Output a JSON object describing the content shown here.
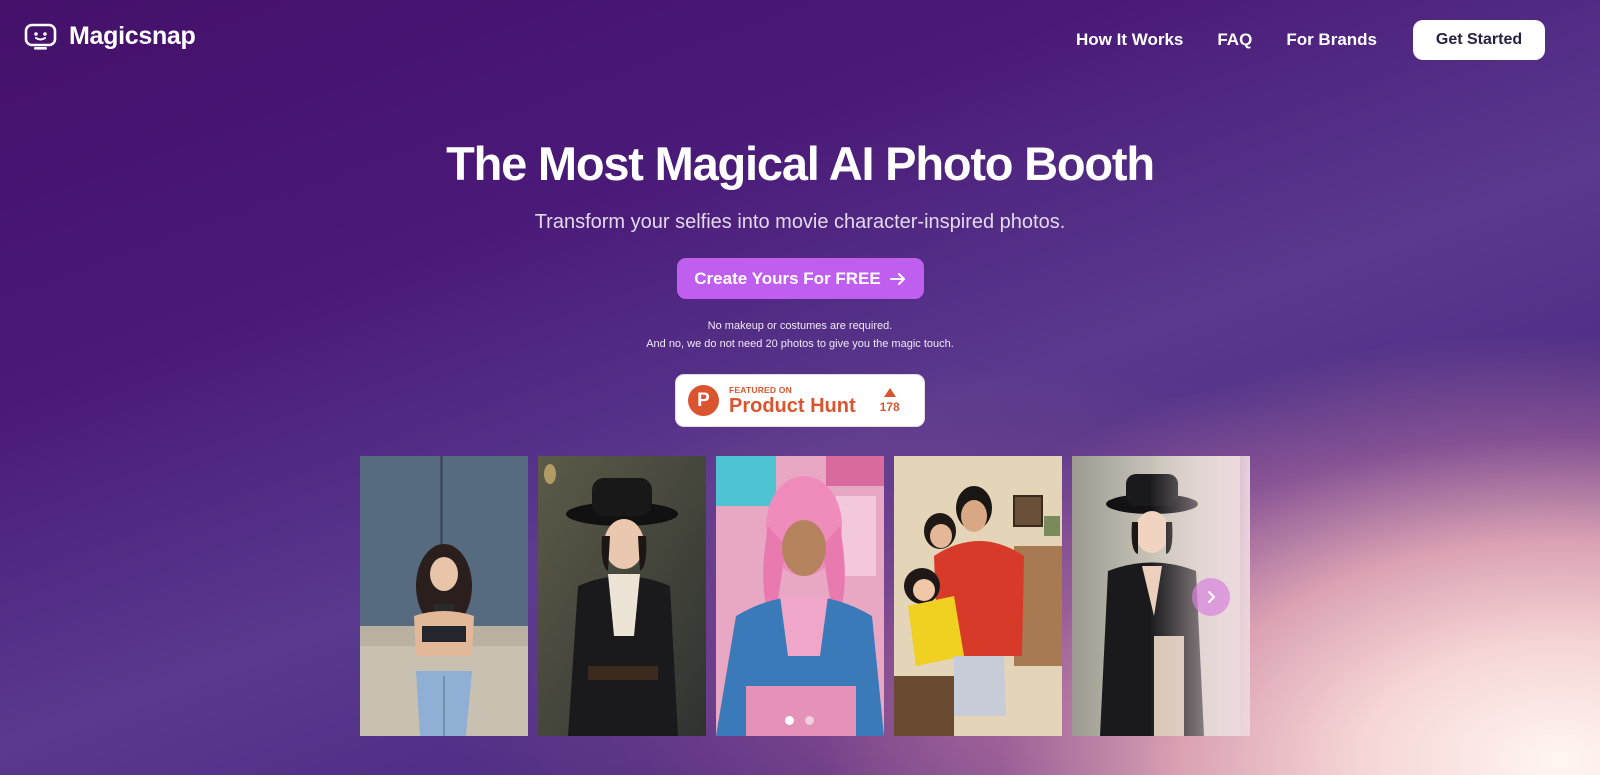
{
  "brand": {
    "name": "Magicsnap",
    "icon": "tv-face-icon"
  },
  "nav": {
    "links": [
      "How It Works",
      "FAQ",
      "For Brands"
    ],
    "cta": "Get Started"
  },
  "hero": {
    "title": "The Most Magical AI Photo Booth",
    "subtitle": "Transform your selfies into movie character-inspired photos.",
    "cta": "Create Yours For FREE",
    "cta_icon": "arrow-right-icon",
    "note1": "No makeup or costumes are required.",
    "note2": "And no, we do not need 20 photos to give you the magic touch."
  },
  "product_hunt": {
    "featured_label": "FEATURED ON",
    "name": "Product Hunt",
    "letter": "P",
    "upvotes": "178"
  },
  "carousel": {
    "photos": [
      "girl-on-rooftop-photo",
      "woman-in-black-hat-photo",
      "man-with-pink-hair-photo",
      "anime-family-photo",
      "woman-in-black-dress-photo"
    ],
    "next_icon": "chevron-right-icon",
    "active_dot": 1,
    "dot_count": 2
  },
  "colors": {
    "accent": "#c05ef0",
    "product_hunt": "#da552f",
    "bg_top": "#44106a",
    "bg_glow": "#f6d6d6"
  }
}
